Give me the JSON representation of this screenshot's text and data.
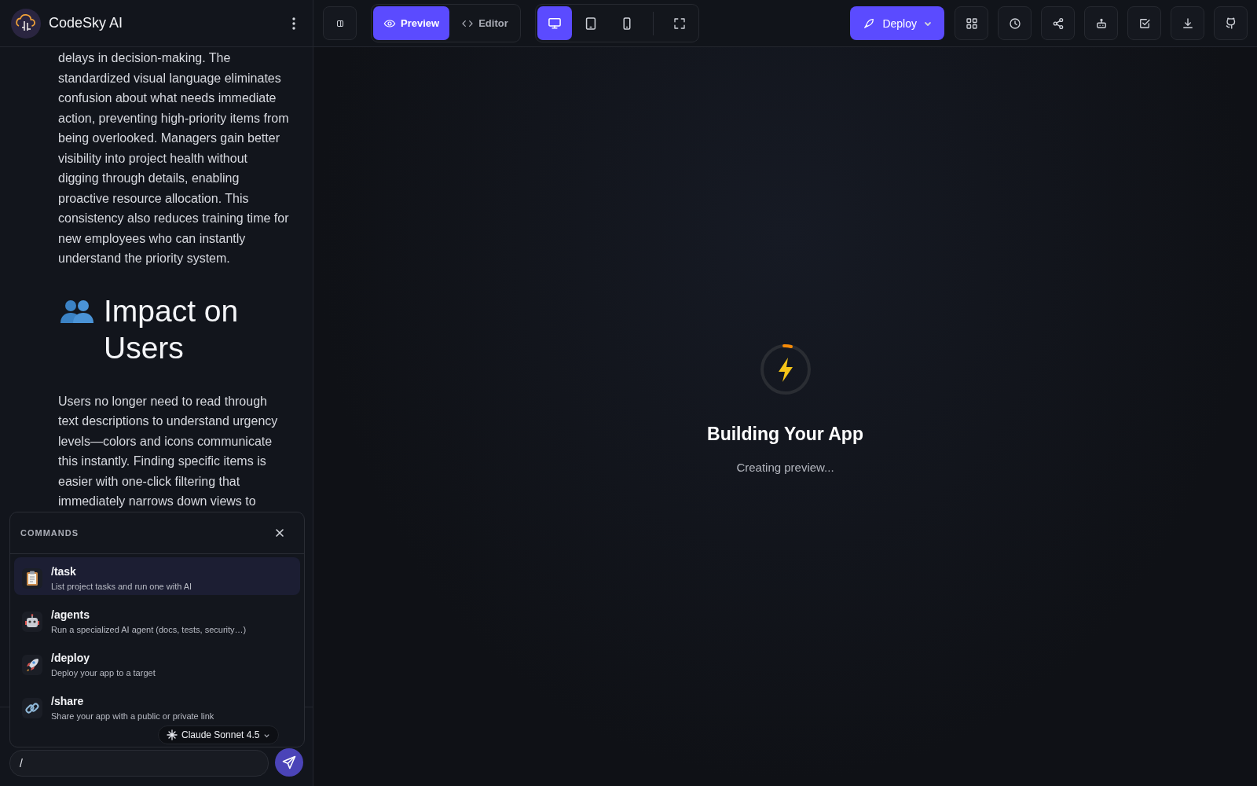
{
  "app": {
    "name": "CodeSky AI"
  },
  "chat": {
    "blocks": [
      {
        "kind": "paragraph",
        "text": "delays in decision-making. The standardized visual language eliminates confusion about what needs immediate action, preventing high-priority items from being overlooked. Managers gain better visibility into project health without digging through details, enabling proactive resource allocation. This consistency also reduces training time for new employees who can instantly understand the priority system."
      },
      {
        "kind": "heading",
        "text": "Impact on Users"
      },
      {
        "kind": "paragraph",
        "text": "Users no longer need to read through text descriptions to understand urgency levels—colors and icons communicate this instantly. Finding specific items is easier with one-click filtering that immediately narrows down views to"
      }
    ]
  },
  "commands": {
    "title": "COMMANDS",
    "items": [
      {
        "kind": "task",
        "name": "/task",
        "description": "List project tasks and run one with AI",
        "selected": true
      },
      {
        "kind": "agents",
        "name": "/agents",
        "description": "Run a specialized AI agent (docs, tests, security…)",
        "selected": false
      },
      {
        "kind": "deploy",
        "name": "/deploy",
        "description": "Deploy your app to a target",
        "selected": false
      },
      {
        "kind": "share",
        "name": "/share",
        "description": "Share your app with a public or private link",
        "selected": false
      }
    ]
  },
  "model": {
    "label": "Claude Sonnet 4.5"
  },
  "input": {
    "value": "/"
  },
  "view_tabs": [
    {
      "kind": "preview",
      "label": "Preview",
      "selected": true
    },
    {
      "kind": "editor",
      "label": "Editor",
      "selected": false
    }
  ],
  "devices": [
    {
      "kind": "desktop",
      "selected": true
    },
    {
      "kind": "tablet",
      "selected": false
    },
    {
      "kind": "mobile",
      "selected": false
    }
  ],
  "deploy": {
    "label": "Deploy"
  },
  "actions": [
    {
      "kind": "grid"
    },
    {
      "kind": "history"
    },
    {
      "kind": "share"
    },
    {
      "kind": "robot"
    },
    {
      "kind": "check"
    },
    {
      "kind": "download"
    },
    {
      "kind": "github"
    }
  ],
  "preview": {
    "title": "Building Your App",
    "subtitle": "Creating preview..."
  }
}
